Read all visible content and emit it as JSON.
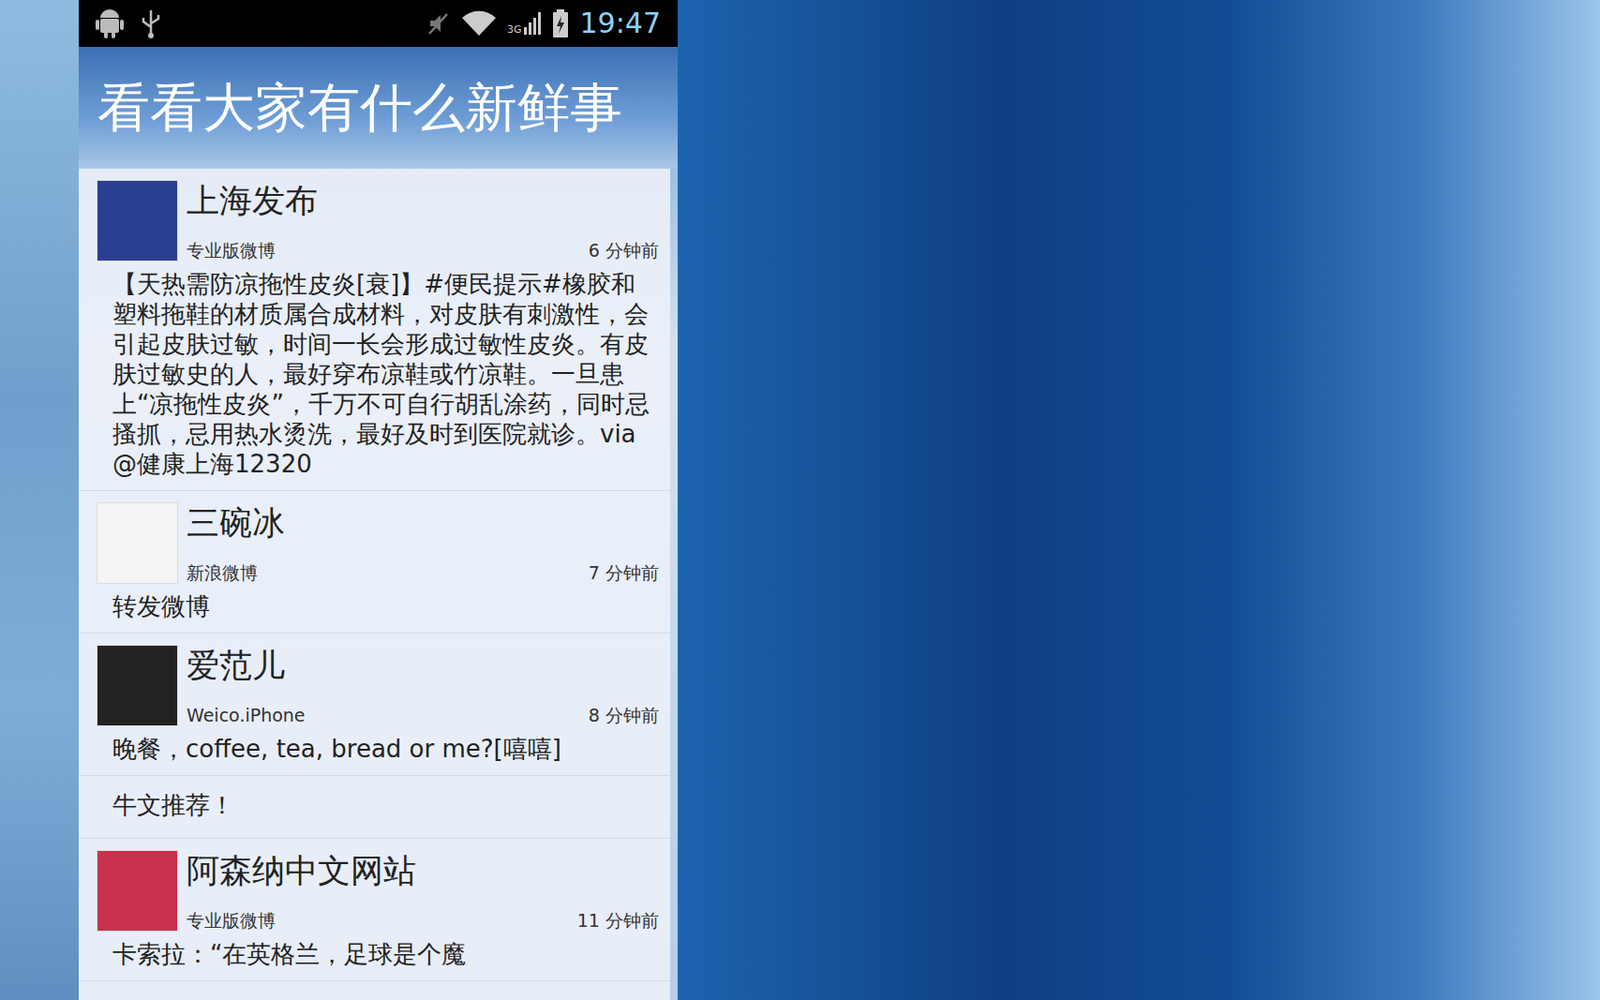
{
  "status_bar": {
    "network": "3G",
    "time": "19:47"
  },
  "title": "看看大家有什么新鲜事",
  "posts": [
    {
      "kind": "post",
      "name": "上海发布",
      "source": "专业版微博",
      "time": "6 分钟前",
      "color": "#2b3f92",
      "text": "【天热需防凉拖性皮炎[衰]】#便民提示#橡胶和塑料拖鞋的材质属合成材料，对皮肤有刺激性，会引起皮肤过敏，时间一长会形成过敏性皮炎。有皮肤过敏史的人，最好穿布凉鞋或竹凉鞋。一旦患上“凉拖性皮炎”，千万不可自行胡乱涂药，同时忌搔抓，忌用热水烫洗，最好及时到医院就诊。via@健康上海12320"
    },
    {
      "kind": "post",
      "name": "三碗冰",
      "source": "新浪微博",
      "time": "7 分钟前",
      "color": "#f4f4f4",
      "text": "转发微博"
    },
    {
      "kind": "post",
      "name": "爱范儿",
      "source": "Weico.iPhone",
      "time": "8 分钟前",
      "color": "#222222",
      "text": "晚餐，coffee, tea, bread or me?[嘻嘻]"
    },
    {
      "kind": "text",
      "text": "牛文推荐！"
    },
    {
      "kind": "post",
      "name": "阿森纳中文网站",
      "source": "专业版微博",
      "time": "11 分钟前",
      "color": "#c8324c",
      "text": "卡索拉：“在英格兰，足球是个魔"
    }
  ]
}
